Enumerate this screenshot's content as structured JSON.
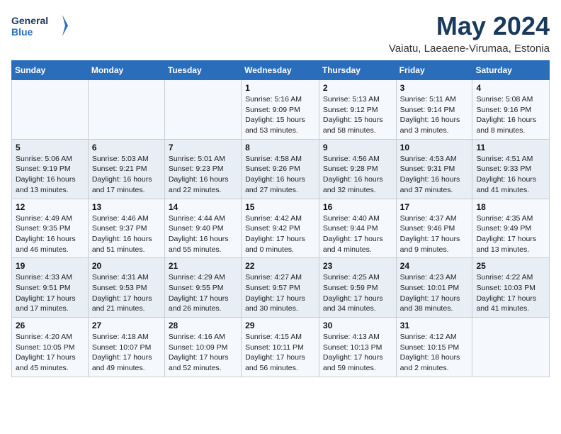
{
  "header": {
    "logo_line1": "General",
    "logo_line2": "Blue",
    "month_title": "May 2024",
    "subtitle": "Vaiatu, Laeaene-Virumaa, Estonia"
  },
  "days_of_week": [
    "Sunday",
    "Monday",
    "Tuesday",
    "Wednesday",
    "Thursday",
    "Friday",
    "Saturday"
  ],
  "weeks": [
    [
      {
        "num": "",
        "info": ""
      },
      {
        "num": "",
        "info": ""
      },
      {
        "num": "",
        "info": ""
      },
      {
        "num": "1",
        "info": "Sunrise: 5:16 AM\nSunset: 9:09 PM\nDaylight: 15 hours\nand 53 minutes."
      },
      {
        "num": "2",
        "info": "Sunrise: 5:13 AM\nSunset: 9:12 PM\nDaylight: 15 hours\nand 58 minutes."
      },
      {
        "num": "3",
        "info": "Sunrise: 5:11 AM\nSunset: 9:14 PM\nDaylight: 16 hours\nand 3 minutes."
      },
      {
        "num": "4",
        "info": "Sunrise: 5:08 AM\nSunset: 9:16 PM\nDaylight: 16 hours\nand 8 minutes."
      }
    ],
    [
      {
        "num": "5",
        "info": "Sunrise: 5:06 AM\nSunset: 9:19 PM\nDaylight: 16 hours\nand 13 minutes."
      },
      {
        "num": "6",
        "info": "Sunrise: 5:03 AM\nSunset: 9:21 PM\nDaylight: 16 hours\nand 17 minutes."
      },
      {
        "num": "7",
        "info": "Sunrise: 5:01 AM\nSunset: 9:23 PM\nDaylight: 16 hours\nand 22 minutes."
      },
      {
        "num": "8",
        "info": "Sunrise: 4:58 AM\nSunset: 9:26 PM\nDaylight: 16 hours\nand 27 minutes."
      },
      {
        "num": "9",
        "info": "Sunrise: 4:56 AM\nSunset: 9:28 PM\nDaylight: 16 hours\nand 32 minutes."
      },
      {
        "num": "10",
        "info": "Sunrise: 4:53 AM\nSunset: 9:31 PM\nDaylight: 16 hours\nand 37 minutes."
      },
      {
        "num": "11",
        "info": "Sunrise: 4:51 AM\nSunset: 9:33 PM\nDaylight: 16 hours\nand 41 minutes."
      }
    ],
    [
      {
        "num": "12",
        "info": "Sunrise: 4:49 AM\nSunset: 9:35 PM\nDaylight: 16 hours\nand 46 minutes."
      },
      {
        "num": "13",
        "info": "Sunrise: 4:46 AM\nSunset: 9:37 PM\nDaylight: 16 hours\nand 51 minutes."
      },
      {
        "num": "14",
        "info": "Sunrise: 4:44 AM\nSunset: 9:40 PM\nDaylight: 16 hours\nand 55 minutes."
      },
      {
        "num": "15",
        "info": "Sunrise: 4:42 AM\nSunset: 9:42 PM\nDaylight: 17 hours\nand 0 minutes."
      },
      {
        "num": "16",
        "info": "Sunrise: 4:40 AM\nSunset: 9:44 PM\nDaylight: 17 hours\nand 4 minutes."
      },
      {
        "num": "17",
        "info": "Sunrise: 4:37 AM\nSunset: 9:46 PM\nDaylight: 17 hours\nand 9 minutes."
      },
      {
        "num": "18",
        "info": "Sunrise: 4:35 AM\nSunset: 9:49 PM\nDaylight: 17 hours\nand 13 minutes."
      }
    ],
    [
      {
        "num": "19",
        "info": "Sunrise: 4:33 AM\nSunset: 9:51 PM\nDaylight: 17 hours\nand 17 minutes."
      },
      {
        "num": "20",
        "info": "Sunrise: 4:31 AM\nSunset: 9:53 PM\nDaylight: 17 hours\nand 21 minutes."
      },
      {
        "num": "21",
        "info": "Sunrise: 4:29 AM\nSunset: 9:55 PM\nDaylight: 17 hours\nand 26 minutes."
      },
      {
        "num": "22",
        "info": "Sunrise: 4:27 AM\nSunset: 9:57 PM\nDaylight: 17 hours\nand 30 minutes."
      },
      {
        "num": "23",
        "info": "Sunrise: 4:25 AM\nSunset: 9:59 PM\nDaylight: 17 hours\nand 34 minutes."
      },
      {
        "num": "24",
        "info": "Sunrise: 4:23 AM\nSunset: 10:01 PM\nDaylight: 17 hours\nand 38 minutes."
      },
      {
        "num": "25",
        "info": "Sunrise: 4:22 AM\nSunset: 10:03 PM\nDaylight: 17 hours\nand 41 minutes."
      }
    ],
    [
      {
        "num": "26",
        "info": "Sunrise: 4:20 AM\nSunset: 10:05 PM\nDaylight: 17 hours\nand 45 minutes."
      },
      {
        "num": "27",
        "info": "Sunrise: 4:18 AM\nSunset: 10:07 PM\nDaylight: 17 hours\nand 49 minutes."
      },
      {
        "num": "28",
        "info": "Sunrise: 4:16 AM\nSunset: 10:09 PM\nDaylight: 17 hours\nand 52 minutes."
      },
      {
        "num": "29",
        "info": "Sunrise: 4:15 AM\nSunset: 10:11 PM\nDaylight: 17 hours\nand 56 minutes."
      },
      {
        "num": "30",
        "info": "Sunrise: 4:13 AM\nSunset: 10:13 PM\nDaylight: 17 hours\nand 59 minutes."
      },
      {
        "num": "31",
        "info": "Sunrise: 4:12 AM\nSunset: 10:15 PM\nDaylight: 18 hours\nand 2 minutes."
      },
      {
        "num": "",
        "info": ""
      }
    ]
  ]
}
